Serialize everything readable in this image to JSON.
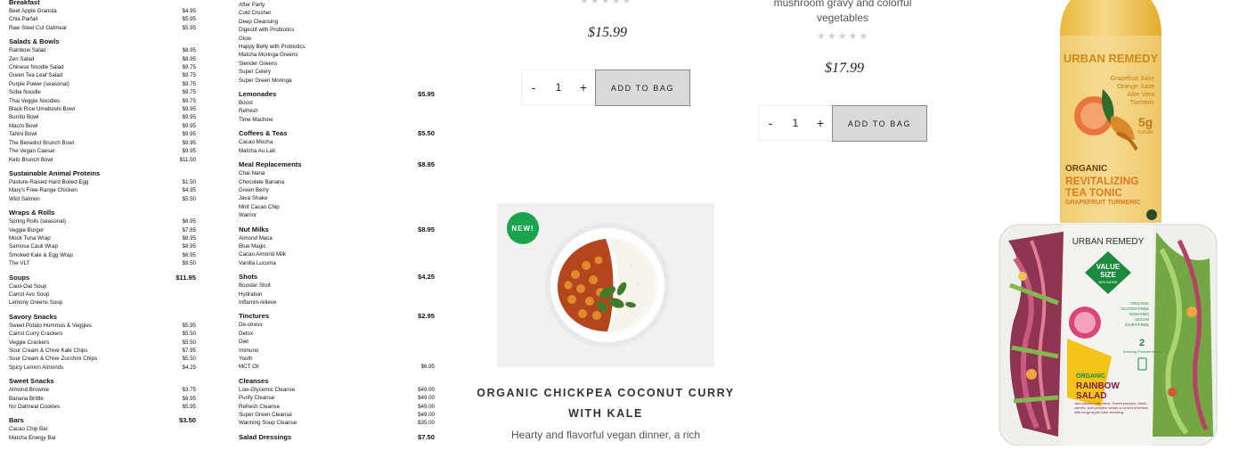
{
  "menu": {
    "col1": [
      {
        "t": "sec",
        "label": "Breakfast"
      },
      {
        "t": "item",
        "name": "Beet Apple Granola",
        "price": "$4.95"
      },
      {
        "t": "item",
        "name": "Chia Parfait",
        "price": "$5.95"
      },
      {
        "t": "item",
        "name": "Raw Steel Cut Oatmeal",
        "price": "$5.95"
      },
      {
        "t": "sec",
        "label": "Salads & Bowls"
      },
      {
        "t": "item",
        "name": "Rainbow Salad",
        "price": "$8.95"
      },
      {
        "t": "item",
        "name": "Zen Salad",
        "price": "$8.95"
      },
      {
        "t": "item",
        "name": "Chinese Noodle Salad",
        "price": "$9.75"
      },
      {
        "t": "item",
        "name": "Green Tea Leaf Salad",
        "price": "$9.75"
      },
      {
        "t": "item",
        "name": "Purple Power (seasonal)",
        "price": "$9.75"
      },
      {
        "t": "item",
        "name": "Soba Noodle",
        "price": "$9.75"
      },
      {
        "t": "item",
        "name": "Thai Veggie Noodles",
        "price": "$9.75"
      },
      {
        "t": "item",
        "name": "Black Rice Umeboshi Bowl",
        "price": "$9.95"
      },
      {
        "t": "item",
        "name": "Burrito Bowl",
        "price": "$9.95"
      },
      {
        "t": "item",
        "name": "Macro Bowl",
        "price": "$9.95"
      },
      {
        "t": "item",
        "name": "Tahini Bowl",
        "price": "$9.95"
      },
      {
        "t": "item",
        "name": "The Benedict Brunch Bowl",
        "price": "$9.95"
      },
      {
        "t": "item",
        "name": "The Vegan Caesar",
        "price": "$9.95"
      },
      {
        "t": "item",
        "name": "Keto Brunch Bowl",
        "price": "$11.50"
      },
      {
        "t": "sec",
        "label": "Sustainable Animal Proteins"
      },
      {
        "t": "item",
        "name": "Pasture-Raised Hard Boiled Egg",
        "price": "$1.50"
      },
      {
        "t": "item",
        "name": "Mary's Free-Range Chicken",
        "price": "$4.95"
      },
      {
        "t": "item",
        "name": "Wild Salmon",
        "price": "$5.50"
      },
      {
        "t": "sec",
        "label": "Wraps & Rolls"
      },
      {
        "t": "item",
        "name": "Spring Rolls (seasonal)",
        "price": "$6.95"
      },
      {
        "t": "item",
        "name": "Veggie Burger",
        "price": "$7.85"
      },
      {
        "t": "item",
        "name": "Mock Tuna Wrap",
        "price": "$8.95"
      },
      {
        "t": "item",
        "name": "Samosa Cauli Wrap",
        "price": "$8.95"
      },
      {
        "t": "item",
        "name": "Smoked Kale & Egg Wrap",
        "price": "$6.95"
      },
      {
        "t": "item",
        "name": "The VLT",
        "price": "$9.50"
      },
      {
        "t": "sec",
        "label": "Soups",
        "price": "$11.95"
      },
      {
        "t": "plain",
        "name": "Cauli-Oat Soup"
      },
      {
        "t": "plain",
        "name": "Carrot Avo Soup"
      },
      {
        "t": "plain",
        "name": "Lemony Greens Soup"
      },
      {
        "t": "sec",
        "label": "Savory Snacks"
      },
      {
        "t": "item",
        "name": "Sweet Potato Hummus & Veggies",
        "price": "$5.95"
      },
      {
        "t": "item",
        "name": "Carrot Curry Crackers",
        "price": "$5.50"
      },
      {
        "t": "item",
        "name": "Veggie Crackers",
        "price": "$5.50"
      },
      {
        "t": "item",
        "name": "Sour Cream & Chive Kale Chips",
        "price": "$7.95"
      },
      {
        "t": "item",
        "name": "Sour Cream & Chive Zucchini Chips",
        "price": "$5.50"
      },
      {
        "t": "item",
        "name": "Spicy Lemon Almonds",
        "price": "$4.25"
      },
      {
        "t": "sec",
        "label": "Sweet Snacks"
      },
      {
        "t": "item",
        "name": "Almond Brownie",
        "price": "$3.75"
      },
      {
        "t": "item",
        "name": "Banana Brittle",
        "price": "$6.95"
      },
      {
        "t": "item",
        "name": "No Oatmeal Cookies",
        "price": "$5.95"
      },
      {
        "t": "sec",
        "label": "Bars",
        "price": "$3.50"
      },
      {
        "t": "plain",
        "name": "Cacao Chip Bar"
      },
      {
        "t": "plain",
        "name": "Matcha Energy Bar"
      }
    ],
    "col2": [
      {
        "t": "plain",
        "name": "After Party"
      },
      {
        "t": "plain",
        "name": "Cold Crusher"
      },
      {
        "t": "plain",
        "name": "Deep Cleansing"
      },
      {
        "t": "plain",
        "name": "Digestif with Probiotics"
      },
      {
        "t": "plain",
        "name": "Glow"
      },
      {
        "t": "plain",
        "name": "Happy Belly with Probiotics"
      },
      {
        "t": "plain",
        "name": "Matcha Moringa Greens"
      },
      {
        "t": "plain",
        "name": "Slender Greens"
      },
      {
        "t": "plain",
        "name": "Super Celery"
      },
      {
        "t": "plain",
        "name": "Super Green Moringa"
      },
      {
        "t": "sec",
        "label": "Lemonades",
        "price": "$5.95"
      },
      {
        "t": "plain",
        "name": "Boost"
      },
      {
        "t": "plain",
        "name": "Refresh"
      },
      {
        "t": "plain",
        "name": "Time Machine"
      },
      {
        "t": "sec",
        "label": "Coffees & Teas",
        "price": "$5.50"
      },
      {
        "t": "plain",
        "name": "Cacao Mocha"
      },
      {
        "t": "plain",
        "name": "Matcha Au Lait"
      },
      {
        "t": "sec",
        "label": "Meal Replacements",
        "price": "$8.95"
      },
      {
        "t": "plain",
        "name": "Chai Nana"
      },
      {
        "t": "plain",
        "name": "Chocolate Banana"
      },
      {
        "t": "plain",
        "name": "Green Berry"
      },
      {
        "t": "plain",
        "name": "Java Shake"
      },
      {
        "t": "plain",
        "name": "Mint Cacao Chip"
      },
      {
        "t": "plain",
        "name": "Warrior"
      },
      {
        "t": "sec",
        "label": "Nut Milks",
        "price": "$8.95"
      },
      {
        "t": "plain",
        "name": "Almond Maca"
      },
      {
        "t": "plain",
        "name": "Blue Magic"
      },
      {
        "t": "plain",
        "name": "Cacao Almond Milk"
      },
      {
        "t": "plain",
        "name": "Vanilla Lucuma"
      },
      {
        "t": "sec",
        "label": "Shots",
        "price": "$4.25"
      },
      {
        "t": "plain",
        "name": "Booster Shot"
      },
      {
        "t": "plain",
        "name": "Hydration"
      },
      {
        "t": "plain",
        "name": "Inflamm-relieve"
      },
      {
        "t": "sec",
        "label": "Tinctures",
        "price": "$2.95"
      },
      {
        "t": "plain",
        "name": "De-stress"
      },
      {
        "t": "plain",
        "name": "Detox"
      },
      {
        "t": "plain",
        "name": "Diet"
      },
      {
        "t": "plain",
        "name": "Immuno"
      },
      {
        "t": "plain",
        "name": "Youth"
      },
      {
        "t": "item",
        "name": "MCT Oil",
        "price": "$6.95"
      },
      {
        "t": "sec",
        "label": "Cleanses"
      },
      {
        "t": "item",
        "name": "Low-Glycemic Cleanse",
        "price": "$49.00"
      },
      {
        "t": "item",
        "name": "Purify Cleanse",
        "price": "$49.00"
      },
      {
        "t": "item",
        "name": "Refresh Cleanse",
        "price": "$49.00"
      },
      {
        "t": "item",
        "name": "Super Green Cleanse",
        "price": "$49.00"
      },
      {
        "t": "item",
        "name": "Warming Soup Cleanse",
        "price": "$35.00"
      },
      {
        "t": "sec",
        "label": "Salad Dressings",
        "price": "$7.50"
      }
    ]
  },
  "product1": {
    "stars": "★★★★★",
    "rating": 0,
    "price": "$15.99",
    "minus": "-",
    "qty": "1",
    "plus": "+",
    "add_label": "ADD TO BAG"
  },
  "product2": {
    "desc_line1": "mushroom gravy and colorful",
    "desc_line2": "vegetables",
    "stars": "★★★★★",
    "rating": 0,
    "price": "$17.99",
    "minus": "-",
    "qty": "1",
    "plus": "+",
    "add_label": "ADD TO BAG"
  },
  "product3": {
    "badge": "NEW!",
    "title_line1": "ORGANIC CHICKPEA COCONUT CURRY",
    "title_line2": "WITH KALE",
    "desc": "Hearty and flavorful vegan dinner, a rich"
  },
  "bottle": {
    "brand": "URBAN REMEDY",
    "ingredients": [
      "Grapefruit Juice",
      "Orange Juice",
      "Aloe Vera",
      "Turmeric"
    ],
    "sugar": "5g",
    "sugar_label": "SUGAR",
    "organic": "ORGANIC",
    "line1": "REVITALIZING",
    "line2": "TEA TONIC",
    "line3": "GRAPEFRUIT TURMERIC"
  },
  "salad": {
    "brand": "URBAN REMEDY",
    "value": "VALUE",
    "size": "SIZE",
    "more": "60% MORE",
    "claims": [
      "ORGANIC",
      "GLUTEN-FREE",
      "NON-GMO",
      "VEGAN",
      "DAIRY-FREE"
    ],
    "dressing_count": "2",
    "dressing_label": "Dressing Pouches Inside",
    "organic": "ORGANIC",
    "name1": "RAINBOW",
    "name2": "SALAD",
    "blurb": "Jam packed with flavor. Sweet peppers, beets, carrots, and pumpkin seeds on a bed of lettuce with tangy apple cider dressing."
  },
  "colors": {
    "new_badge": "#1aa44f",
    "button_bg": "#d9d9d9",
    "stars": "#cfcfcf"
  }
}
